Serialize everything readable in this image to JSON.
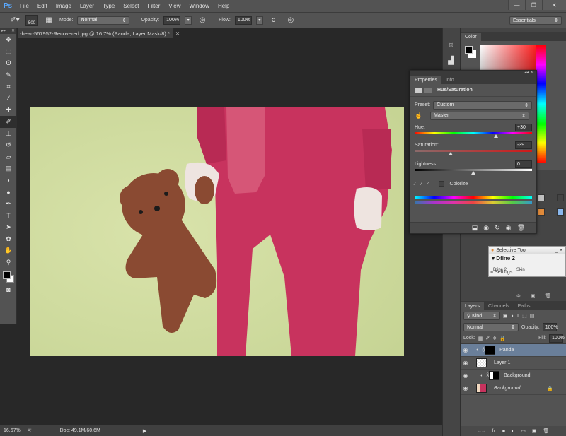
{
  "app": {
    "logo": "Ps"
  },
  "menu": [
    "File",
    "Edit",
    "Image",
    "Layer",
    "Type",
    "Select",
    "Filter",
    "View",
    "Window",
    "Help"
  ],
  "window_controls": {
    "minimize": "—",
    "restore": "❐",
    "close": "✕"
  },
  "options": {
    "brush_size": "500",
    "mode_label": "Mode:",
    "mode_value": "Normal",
    "opacity_label": "Opacity:",
    "opacity_value": "100%",
    "flow_label": "Flow:",
    "flow_value": "100%",
    "workspace": "Essentials"
  },
  "document": {
    "tab_title": "-bear-567952-Recovered.jpg @ 16.7% (Panda, Layer Mask/8) *",
    "close": "✕"
  },
  "tools": [
    {
      "name": "move-tool",
      "glyph": "✥"
    },
    {
      "name": "marquee-tool",
      "glyph": "⬚"
    },
    {
      "name": "lasso-tool",
      "glyph": "ʘ"
    },
    {
      "name": "quick-select-tool",
      "glyph": "✎"
    },
    {
      "name": "crop-tool",
      "glyph": "⌗"
    },
    {
      "name": "eyedropper-tool",
      "glyph": "⁄"
    },
    {
      "name": "healing-brush-tool",
      "glyph": "✚"
    },
    {
      "name": "brush-tool",
      "glyph": "✐"
    },
    {
      "name": "clone-stamp-tool",
      "glyph": "⊥"
    },
    {
      "name": "history-brush-tool",
      "glyph": "↺"
    },
    {
      "name": "eraser-tool",
      "glyph": "▱"
    },
    {
      "name": "gradient-tool",
      "glyph": "▤"
    },
    {
      "name": "blur-tool",
      "glyph": "◗"
    },
    {
      "name": "dodge-tool",
      "glyph": "●"
    },
    {
      "name": "pen-tool",
      "glyph": "✒"
    },
    {
      "name": "type-tool",
      "glyph": "T"
    },
    {
      "name": "path-select-tool",
      "glyph": "➤"
    },
    {
      "name": "shape-tool",
      "glyph": "✿"
    },
    {
      "name": "hand-tool",
      "glyph": "✋"
    },
    {
      "name": "zoom-tool",
      "glyph": "⚲"
    }
  ],
  "status": {
    "zoom": "16.67%",
    "doc": "Doc: 49.1M/60.6M"
  },
  "color_panel": {
    "tab": "Color"
  },
  "properties": {
    "tabs": [
      "Properties",
      "Info"
    ],
    "title": "Hue/Saturation",
    "preset_label": "Preset:",
    "preset_value": "Custom",
    "channel_value": "Master",
    "hue_label": "Hue:",
    "hue_value": "+30",
    "saturation_label": "Saturation:",
    "saturation_value": "-39",
    "lightness_label": "Lightness:",
    "lightness_value": "0",
    "colorize_label": "Colorize",
    "hue_pct": 0.69,
    "saturation_pct": 0.31,
    "lightness_pct": 0.5
  },
  "selective_tool": {
    "title": "Selective Tool",
    "heading": "Dfine 2",
    "settings": "Settings",
    "row_a": "Dfine 2",
    "row_b": "Skin"
  },
  "layers_panel": {
    "tabs": [
      "Layers",
      "Channels",
      "Paths"
    ],
    "filter": "Kind",
    "blend_mode": "Normal",
    "opacity_label": "Opacity:",
    "opacity_value": "100%",
    "lock_label": "Lock:",
    "fill_label": "Fill:",
    "fill_value": "100%",
    "layers": [
      {
        "name": "Panda",
        "selected": true
      },
      {
        "name": "Layer 1",
        "selected": false
      },
      {
        "name": "Background",
        "selected": false
      },
      {
        "name": "Background",
        "selected": false,
        "locked": true
      }
    ]
  }
}
